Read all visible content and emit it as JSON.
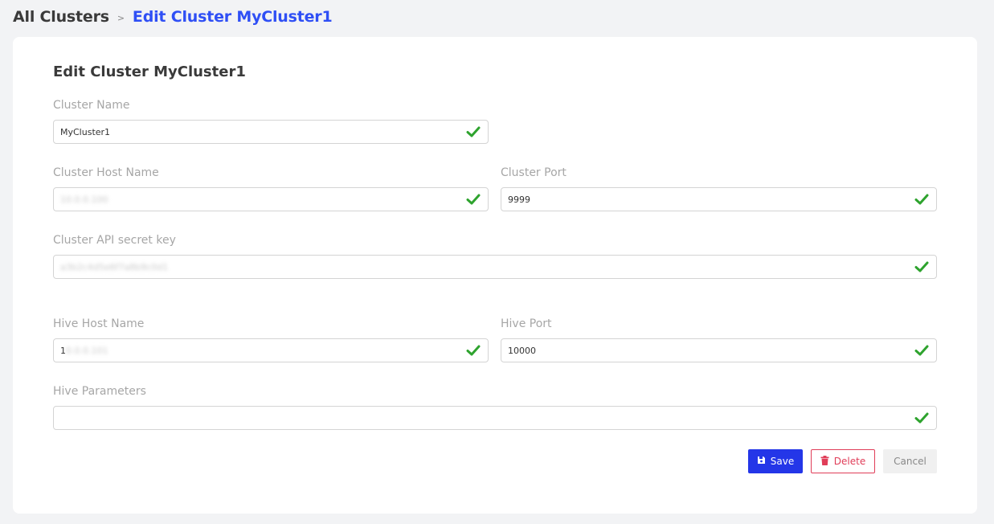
{
  "breadcrumb": {
    "root": "All Clusters",
    "separator": ">",
    "current": "Edit Cluster MyCluster1"
  },
  "form": {
    "title": "Edit Cluster MyCluster1",
    "cluster_name": {
      "label": "Cluster Name",
      "value": "MyCluster1"
    },
    "cluster_host": {
      "label": "Cluster Host Name",
      "value": "10.0.0.100"
    },
    "cluster_port": {
      "label": "Cluster Port",
      "value": "9999"
    },
    "cluster_secret": {
      "label": "Cluster API secret key",
      "value": "a3b2c4d5e6f7a8b9c0d1"
    },
    "hive_host": {
      "label": "Hive Host Name",
      "value": "1",
      "blurred_suffix": "0.0.0.101"
    },
    "hive_port": {
      "label": "Hive Port",
      "value": "10000"
    },
    "hive_params": {
      "label": "Hive Parameters",
      "value": ""
    }
  },
  "buttons": {
    "save": "Save",
    "delete": "Delete",
    "cancel": "Cancel"
  },
  "colors": {
    "accent": "#2436e8",
    "link": "#2f4ff5",
    "danger": "#e03d58",
    "valid": "#2ea32e"
  },
  "icons": {
    "valid": "check-icon",
    "save": "floppy-disk-icon",
    "delete": "trash-icon"
  }
}
